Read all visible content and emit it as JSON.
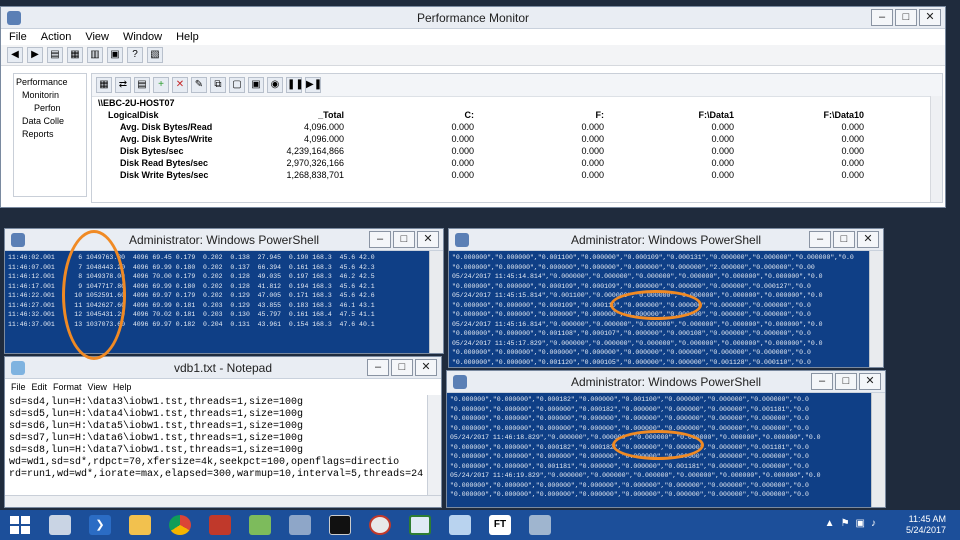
{
  "perfmon": {
    "title": "Performance Monitor",
    "menu": [
      "File",
      "Action",
      "View",
      "Window",
      "Help"
    ],
    "tree": [
      "Performance",
      "Monitorin",
      "Perfon",
      "Data Colle",
      "Reports"
    ],
    "host": "\\\\EBC-2U-HOST07",
    "object": "LogicalDisk",
    "columns": [
      "_Total",
      "C:",
      "F:",
      "F:\\Data1",
      "F:\\Data10"
    ],
    "rows": [
      {
        "label": "Avg. Disk Bytes/Read",
        "values": [
          "4,096.000",
          "0.000",
          "0.000",
          "0.000",
          "0.000"
        ]
      },
      {
        "label": "Avg. Disk Bytes/Write",
        "values": [
          "4,096.000",
          "0.000",
          "0.000",
          "0.000",
          "0.000"
        ]
      },
      {
        "label": "Disk Bytes/sec",
        "values": [
          "4,239,164,866",
          "0.000",
          "0.000",
          "0.000",
          "0.000"
        ]
      },
      {
        "label": "Disk Read Bytes/sec",
        "values": [
          "2,970,326,166",
          "0.000",
          "0.000",
          "0.000",
          "0.000"
        ]
      },
      {
        "label": "Disk Write Bytes/sec",
        "values": [
          "1,268,838,701",
          "0.000",
          "0.000",
          "0.000",
          "0.000"
        ]
      }
    ]
  },
  "ps1": {
    "title": "Administrator: Windows PowerShell",
    "lines": [
      "11:46:02.001      6 1049763.80  4096 69.45 0.179  0.202  0.138  27.945  0.190 168.3  45.6 42.0",
      "11:46:07.001      7 1048443.20  4096 69.99 0.180  0.202  0.137  66.394  0.161 168.3  45.6 42.3",
      "11:46:12.001      8 1049378.00  4096 70.00 0.179  0.202  0.128  49.035  0.197 168.3  46.2 42.5",
      "11:46:17.001      9 1047717.80  4096 69.99 0.180  0.202  0.128  41.812  0.194 168.3  45.6 42.1",
      "11:46:22.001     10 1052591.60  4096 69.97 0.179  0.202  0.129  47.005  0.171 168.3  45.6 42.6",
      "11:46:27.001     11 1042627.60  4096 69.99 0.181  0.203  0.129  43.855  0.183 168.3  46.1 43.1",
      "11:46:32.001     12 1045431.20  4096 70.02 0.181  0.203  0.130  45.797  0.161 168.4  47.5 41.1",
      "11:46:37.001     13 1037073.60  4096 69.97 0.182  0.204  0.131  43.961  0.154 168.3  47.6 40.1"
    ]
  },
  "ps2": {
    "title": "Administrator: Windows PowerShell",
    "lines": [
      "\"0.000000\",\"0.000000\",\"0.001100\",\"0.000000\",\"0.000109\",\"0.000131\",\"0.000000\",\"0.000000\",\"0.000000\",\"0.0",
      "\"0.000000\",\"0.000000\",\"0.000000\",\"0.000000\",\"0.000000\",\"0.000000\",\"2.000000\",\"0.000000\",\"0.00",
      "05/24/2017 11:45:14.814\",\"0.000000\",\"0.000000\",\"0.000000\",\"0.000000\",\"0.000000\",\"0.000000\",\"0.0",
      "\"0.000000\",\"0.000000\",\"0.000109\",\"0.000109\",\"0.000000\",\"0.000000\",\"0.000000\",\"0.000127\",\"0.0",
      "05/24/2017 11:45:15.814\",\"0.001100\",\"0.000000\",\"0.000000\",\"0.000000\",\"0.000000\",\"0.000000\",\"0.0",
      "\"0.000000\",\"0.000000\",\"0.000109\",\"0.000110\",\"0.000000\",\"0.000000\",\"0.000000\",\"0.000000\",\"0.0",
      "\"0.000000\",\"0.000000\",\"0.000000\",\"0.000000\",\"0.000000\",\"0.000000\",\"0.000000\",\"0.000000\",\"0.0",
      "05/24/2017 11:45:16.814\",\"0.000000\",\"0.000000\",\"0.000000\",\"0.000000\",\"0.000000\",\"0.000000\",\"0.0",
      "\"0.000000\",\"0.000000\",\"0.001108\",\"0.000107\",\"0.000000\",\"0.000108\",\"0.000000\",\"0.000000\",\"0.0",
      "05/24/2017 11:45:17.829\",\"0.000000\",\"0.000000\",\"0.000000\",\"0.000000\",\"0.000000\",\"0.000000\",\"0.0",
      "\"0.000000\",\"0.000000\",\"0.000000\",\"0.000000\",\"0.000000\",\"0.000000\",\"0.000000\",\"0.000000\",\"0.0",
      "\"0.000000\",\"0.000000\",\"0.001120\",\"0.000105\",\"0.000000\",\"0.000000\",\"0.001128\",\"0.000110\",\"0.0"
    ]
  },
  "notepad": {
    "title": "vdb1.txt - Notepad",
    "menu": [
      "File",
      "Edit",
      "Format",
      "View",
      "Help"
    ],
    "lines": [
      "sd=sd4,lun=H:\\data3\\iobw1.tst,threads=1,size=100g",
      "sd=sd5,lun=H:\\data4\\iobw1.tst,threads=1,size=100g",
      "sd=sd6,lun=H:\\data5\\iobw1.tst,threads=1,size=100g",
      "sd=sd7,lun=H:\\data6\\iobw1.tst,threads=1,size=100g",
      "sd=sd8,lun=H:\\data7\\iobw1.tst,threads=1,size=100g",
      "wd=wd1,sd=sd*,rdpct=70,xfersize=4k,seekpct=100,openflags=directio",
      "rd=run1,wd=wd*,iorate=max,elapsed=300,warmup=10,interval=5,threads=24"
    ]
  },
  "ps3": {
    "title": "Administrator: Windows PowerShell",
    "lines": [
      "\"0.000000\",\"0.000000\",\"0.000182\",\"0.000000\",\"0.001100\",\"0.000000\",\"0.000000\",\"0.000000\",\"0.0",
      "\"0.000000\",\"0.000000\",\"0.000000\",\"0.000182\",\"0.000000\",\"0.000000\",\"0.000000\",\"0.001181\",\"0.0",
      "\"0.000000\",\"0.000000\",\"0.000000\",\"0.000000\",\"0.000000\",\"0.000000\",\"0.000000\",\"0.000000\",\"0.0",
      "\"0.000000\",\"0.000000\",\"0.000000\",\"0.000000\",\"0.000000\",\"0.000000\",\"0.000000\",\"0.000000\",\"0.0",
      "05/24/2017 11:46:18.829\",\"0.000000\",\"0.000000\",\"0.000000\",\"0.000000\",\"0.000000\",\"0.000000\",\"0.0",
      "\"0.000000\",\"0.000000\",\"0.000182\",\"0.000182\",\"0.000000\",\"0.000000\",\"0.000000\",\"0.001181\",\"0.0",
      "\"0.000000\",\"0.000000\",\"0.000000\",\"0.000000\",\"0.000000\",\"0.000000\",\"0.000000\",\"0.000000\",\"0.0",
      "\"0.000000\",\"0.000000\",\"0.001181\",\"0.000000\",\"0.000000\",\"0.001181\",\"0.000000\",\"0.000000\",\"0.0",
      "05/24/2017 11:46:19.829\",\"0.000000\",\"0.000000\",\"0.000000\",\"0.000000\",\"0.000000\",\"0.000000\",\"0.0",
      "\"0.000000\",\"0.000000\",\"0.000000\",\"0.000000\",\"0.000000\",\"0.000000\",\"0.000000\",\"0.000000\",\"0.0",
      "\"0.000000\",\"0.000000\",\"0.000000\",\"0.000000\",\"0.000000\",\"0.000000\",\"0.000000\",\"0.000000\",\"0.0"
    ]
  },
  "taskbar": {
    "apps": [
      "windows-start",
      "server-manager",
      "powershell",
      "file-explorer",
      "chrome",
      "toolbox",
      "task-manager",
      "network",
      "cmd",
      "performance-monitor",
      "notepad",
      "presentation",
      "ft",
      "remote-desktop"
    ],
    "ft_label": "FT",
    "time": "11:45 AM",
    "date": "5/24/2017"
  },
  "colors": {
    "powershell_bg": "#0f3f86",
    "taskbar": "#1c4f9a",
    "highlight": "#f08a24"
  }
}
